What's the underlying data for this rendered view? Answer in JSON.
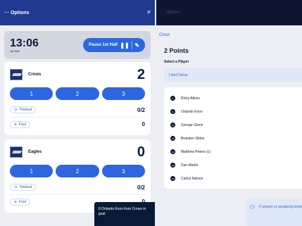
{
  "left": {
    "topbar": {
      "menu": "··· Options",
      "right_glyph": "P"
    },
    "clock": {
      "time": "13:06",
      "half": "1st Half",
      "pause_label": "Pause 1st Half",
      "pause_icon": "pause-icon",
      "edit_icon": "pencil-icon"
    },
    "teams": [
      {
        "name": "Crows",
        "score": "2",
        "points": [
          "1",
          "2",
          "3"
        ],
        "timeout_label": "Timeout",
        "timeout_value": "0/2",
        "foul_label": "Foul",
        "foul_value": "0"
      },
      {
        "name": "Eagles",
        "score": "0",
        "points": [
          "1",
          "2",
          "3"
        ],
        "timeout_label": "Timeout",
        "timeout_value": "0/2",
        "foul_label": "Foul",
        "foul_value": "0"
      }
    ],
    "toast": "8 Orlando Knox from Crows m goal"
  },
  "right": {
    "topbar": "··· Options",
    "close": "Close",
    "title": "2 Points",
    "select_label": "Select a Player",
    "dont_know": "I don't know",
    "players": [
      {
        "num": "5",
        "name": "Ricky Atkins"
      },
      {
        "num": "8",
        "name": "Orlando Knox"
      },
      {
        "num": "12",
        "name": "George Glenn"
      },
      {
        "num": "18",
        "name": "Branden Gibbs"
      },
      {
        "num": "19",
        "name": "Matthew Peters (c)"
      },
      {
        "num": "28",
        "name": "Dan Martin"
      },
      {
        "num": "30",
        "name": "Carlos Nelson"
      }
    ],
    "hint": "If unsure or assigning know."
  },
  "colors": {
    "primary": "#2d66e0",
    "navy": "#0d1b3d",
    "header": "#1f3a8f"
  }
}
